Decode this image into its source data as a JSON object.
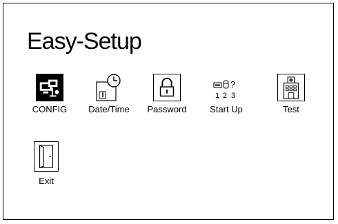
{
  "window": {
    "title": "Easy-Setup"
  },
  "items": [
    {
      "label": "CONFIG",
      "icon": "config-icon",
      "selected": true
    },
    {
      "label": "Date/Time",
      "icon": "clock-calendar-icon"
    },
    {
      "label": "Password",
      "icon": "padlock-icon"
    },
    {
      "label": "Start Up",
      "icon": "startup-sequence-icon",
      "icon_text": [
        "1",
        "2",
        "3",
        "?"
      ]
    },
    {
      "label": "Test",
      "icon": "hospital-test-icon"
    },
    {
      "label": "Exit",
      "icon": "door-exit-icon"
    }
  ]
}
